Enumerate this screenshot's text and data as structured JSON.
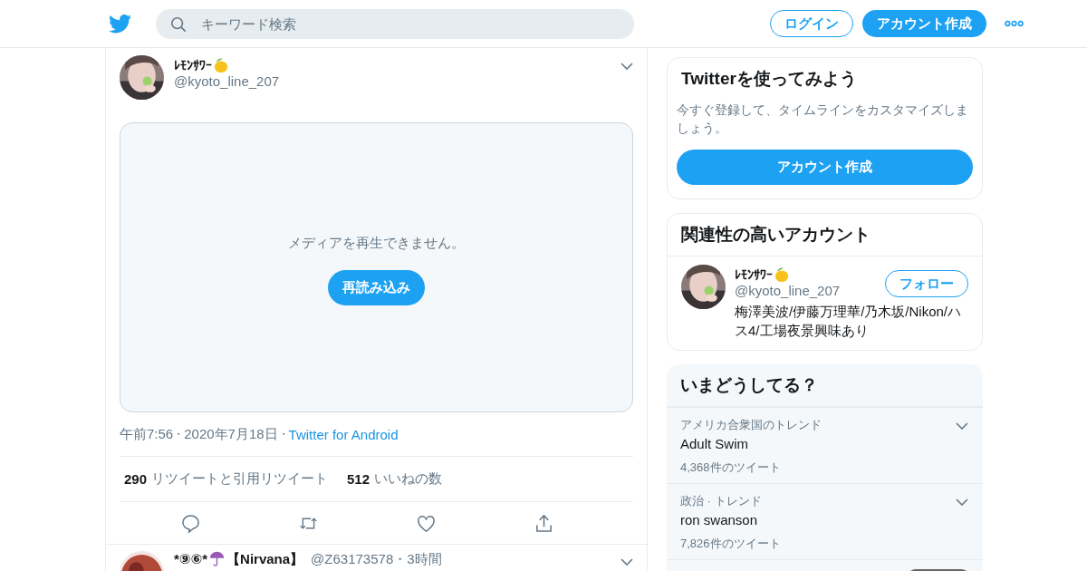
{
  "header": {
    "search": {
      "placeholder": "キーワード検索"
    },
    "login": "ログイン",
    "signup": "アカウント作成"
  },
  "tweet": {
    "name": "ﾚﾓﾝｻﾜｰ",
    "handle": "@kyoto_line_207",
    "media": {
      "message": "メディアを再生できません。",
      "reload": "再読み込み"
    },
    "time": "午前7:56",
    "separator": "・",
    "date": "2020年7月18日",
    "separator_2": "・",
    "source": "Twitter for Android",
    "retweets": "290",
    "retweets_label": "リツイートと引用リツイート",
    "likes": "512",
    "likes_label": "いいねの数"
  },
  "next_tweet": {
    "name_start": "*⑨⑥*",
    "name_end": "【Nirvana】",
    "handle": "@Z63173578",
    "separator": "・",
    "age": "3時間"
  },
  "signup_card": {
    "title": "Twitterを使ってみよう",
    "text": "今すぐ登録して、タイムラインをカスタマイズしましょう。",
    "button": "アカウント作成"
  },
  "related": {
    "title": "関連性の高いアカウント",
    "account": {
      "name": "ﾚﾓﾝｻﾜｰ",
      "handle": "@kyoto_line_207",
      "bio": "梅澤美波/伊藤万理華/乃木坂/Nikon/ハス4/工場夜景興味あり",
      "follow": "フォロー"
    }
  },
  "trends": {
    "title": "いまどうしてる？",
    "items": [
      {
        "context": "アメリカ合衆国のトレンド",
        "name": "Adult Swim",
        "count": "4,368件のツイート"
      },
      {
        "context": "政治 · トレンド",
        "name": "ron swanson",
        "count": "7,826件のツイート"
      }
    ]
  }
}
